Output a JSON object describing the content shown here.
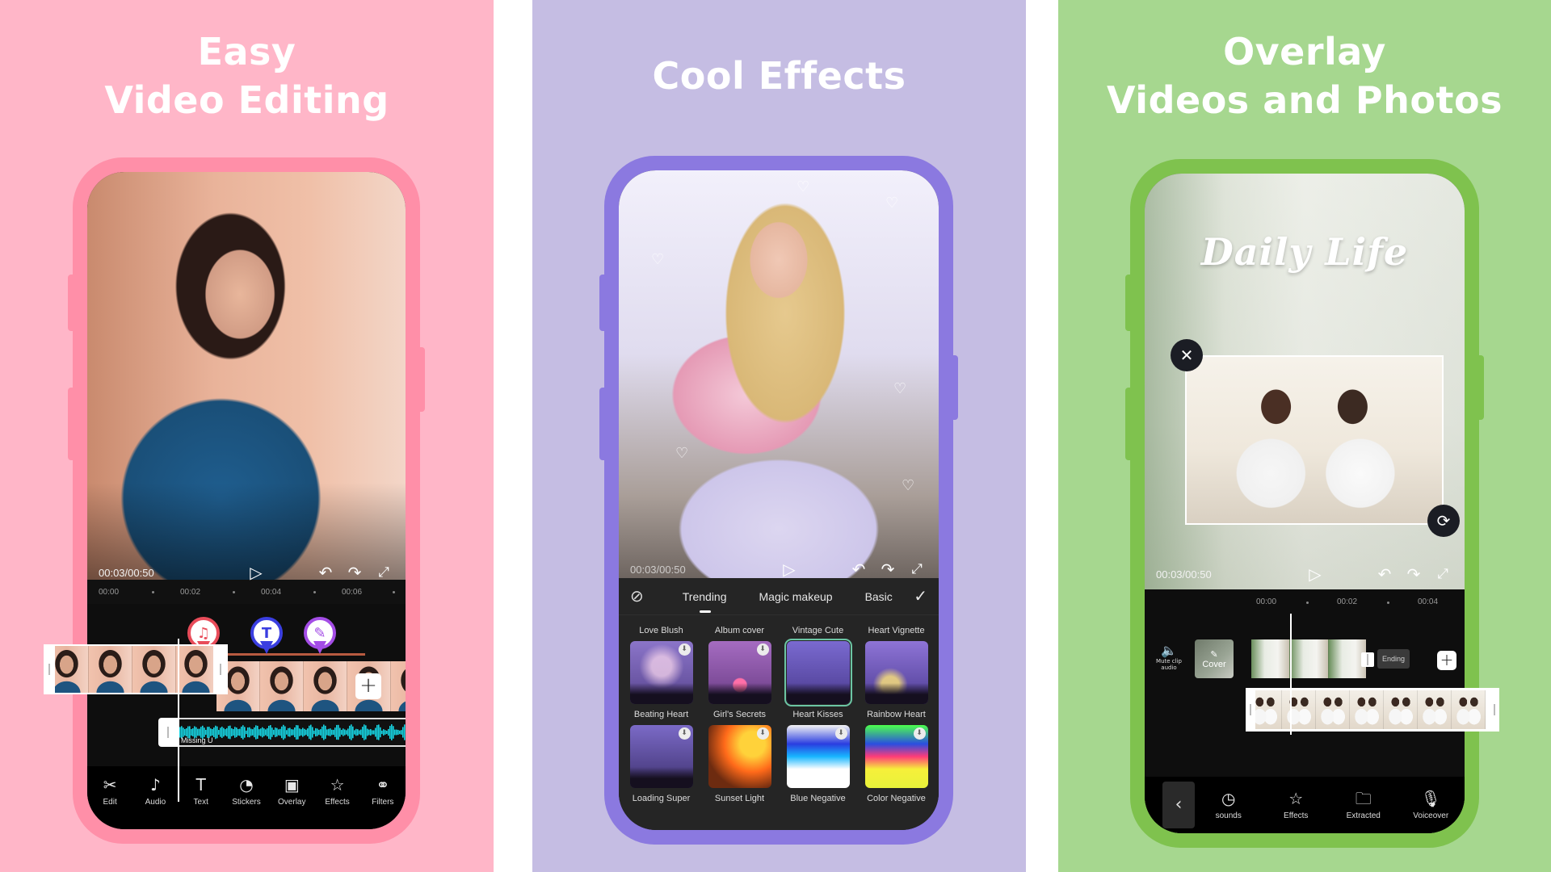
{
  "colors": {
    "panel1_bg": "#ffb6c8",
    "panel1_frame": "#ff8fa8",
    "panel2_bg": "#c5bde3",
    "panel2_frame": "#8b79e0",
    "panel3_bg": "#a6d78f",
    "panel3_frame": "#7fc24e",
    "audio_wave": "#16d7e6",
    "pin_music": "#e84c5a",
    "pin_text": "#3a3ee0",
    "pin_effect": "#a44de6"
  },
  "panels": [
    {
      "title_line1": "Easy",
      "title_line2": "Video Editing",
      "player": {
        "time": "00:03/00:50",
        "icons": [
          "play-icon",
          "undo-icon",
          "redo-icon",
          "fullscreen-icon"
        ]
      },
      "ruler": [
        "00:00",
        "00:02",
        "00:04",
        "00:06"
      ],
      "markers": [
        {
          "icon": "music-note-icon",
          "glyph": "♫"
        },
        {
          "icon": "text-icon",
          "glyph": "T"
        },
        {
          "icon": "magic-wand-icon",
          "glyph": "✎"
        }
      ],
      "add_clip_label": "+",
      "audio_track_label": "Missing U",
      "toolbar": [
        {
          "icon": "scissors-icon",
          "glyph": "✂",
          "label": "Edit"
        },
        {
          "icon": "music-note-icon",
          "glyph": "♪",
          "label": "Audio"
        },
        {
          "icon": "text-icon",
          "glyph": "T",
          "label": "Text"
        },
        {
          "icon": "sticker-icon",
          "glyph": "◔",
          "label": "Stickers"
        },
        {
          "icon": "overlay-icon",
          "glyph": "▣",
          "label": "Overlay"
        },
        {
          "icon": "effects-star-icon",
          "glyph": "☆",
          "label": "Effects"
        },
        {
          "icon": "filters-icon",
          "glyph": "⚭",
          "label": "Filters"
        }
      ]
    },
    {
      "title": "Cool Effects",
      "player": {
        "time": "00:03/00:50",
        "icons": [
          "play-icon",
          "undo-icon",
          "redo-icon",
          "fullscreen-icon"
        ]
      },
      "tabs": {
        "none_icon": "⊘",
        "items": [
          "Trending",
          "Magic makeup",
          "Basic"
        ],
        "active": "Trending",
        "confirm_icon": "✓"
      },
      "effects_rows": [
        {
          "names": [
            "Love Blush",
            "Album cover",
            "Vintage Cute",
            "Heart Vignette"
          ],
          "thumbs": [
            "sparkle-heart",
            "pink-heart",
            "heart-outline",
            "confetti-heart"
          ]
        },
        {
          "names": [
            "Beating Heart",
            "Girl's Secrets",
            "Heart Kisses",
            "Rainbow Heart"
          ],
          "thumbs": [
            "purple-night",
            "sunset-light",
            "blue-negative",
            "color-negative"
          ],
          "selected_index_above": 2
        },
        {
          "names": [
            "Loading Super",
            "Sunset Light",
            "Blue Negative",
            "Color Negative"
          ]
        }
      ]
    },
    {
      "title_line1": "Overlay",
      "title_line2": "Videos and Photos",
      "video_title_text": "Daily Life",
      "player": {
        "time": "00:03/00:50",
        "icons": [
          "play-icon",
          "undo-icon",
          "redo-icon",
          "fullscreen-icon"
        ]
      },
      "overlay_close_glyph": "✕",
      "overlay_rotate_glyph": "⟳",
      "ruler": [
        "00:00",
        "00:02",
        "00:04"
      ],
      "mute_label": "Mute clip audio",
      "cover_label": "Cover",
      "ending_label": "Ending",
      "add_clip_label": "+",
      "back_glyph": "‹",
      "toolbar": [
        {
          "icon": "sounds-icon",
          "glyph": "◷",
          "label": "sounds"
        },
        {
          "icon": "effects-star-icon",
          "glyph": "☆",
          "label": "Effects"
        },
        {
          "icon": "folder-icon",
          "glyph": "🗀",
          "label": "Extracted"
        },
        {
          "icon": "microphone-icon",
          "glyph": "🎙",
          "label": "Voiceover"
        }
      ]
    }
  ]
}
